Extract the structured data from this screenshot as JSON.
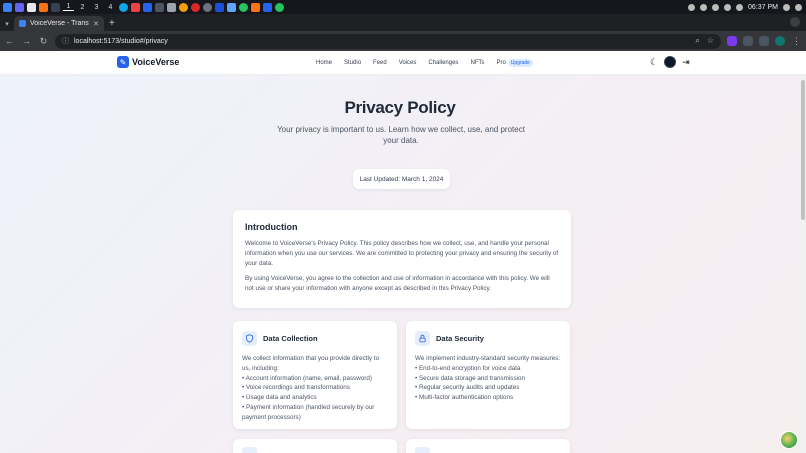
{
  "taskbar": {
    "workspaces": [
      "1",
      "2",
      "3",
      "4"
    ],
    "clock": "06:37 PM"
  },
  "browser": {
    "tab_title": "VoiceVerse - Transform",
    "url": "localhost:5173/studio#/privacy"
  },
  "site": {
    "logo": "VoiceVerse",
    "nav": [
      "Home",
      "Studio",
      "Feed",
      "Voices",
      "Challenges",
      "NFTs"
    ],
    "nav_pro": "Pro",
    "upgrade_badge": "Upgrade"
  },
  "page": {
    "title": "Privacy Policy",
    "subtitle": "Your privacy is important to us. Learn how we collect, use, and protect your data.",
    "last_updated": "Last Updated: March 1, 2024",
    "intro": {
      "heading": "Introduction",
      "p1": "Welcome to VoiceVerse's Privacy Policy. This policy describes how we collect, use, and handle your personal information when you use our services. We are committed to protecting your privacy and ensuring the security of your data.",
      "p2": "By using VoiceVerse, you agree to the collection and use of information in accordance with this policy. We will not use or share your information with anyone except as described in this Privacy Policy."
    },
    "data_collection": {
      "heading": "Data Collection",
      "lead": "We collect information that you provide directly to us, including:",
      "items": [
        "• Account information (name, email, password)",
        "• Voice recordings and transformations",
        "• Usage data and analytics",
        "• Payment information (handled securely by our payment processors)"
      ]
    },
    "data_security": {
      "heading": "Data Security",
      "lead": "We implement industry-standard security measures:",
      "items": [
        "• End-to-end encryption for voice data",
        "• Secure data storage and transmission",
        "• Regular security audits and updates",
        "• Multi-factor authentication options"
      ]
    }
  },
  "colors": {
    "brand": "#2563eb",
    "heading": "#1f2937",
    "body": "#4b5563"
  }
}
